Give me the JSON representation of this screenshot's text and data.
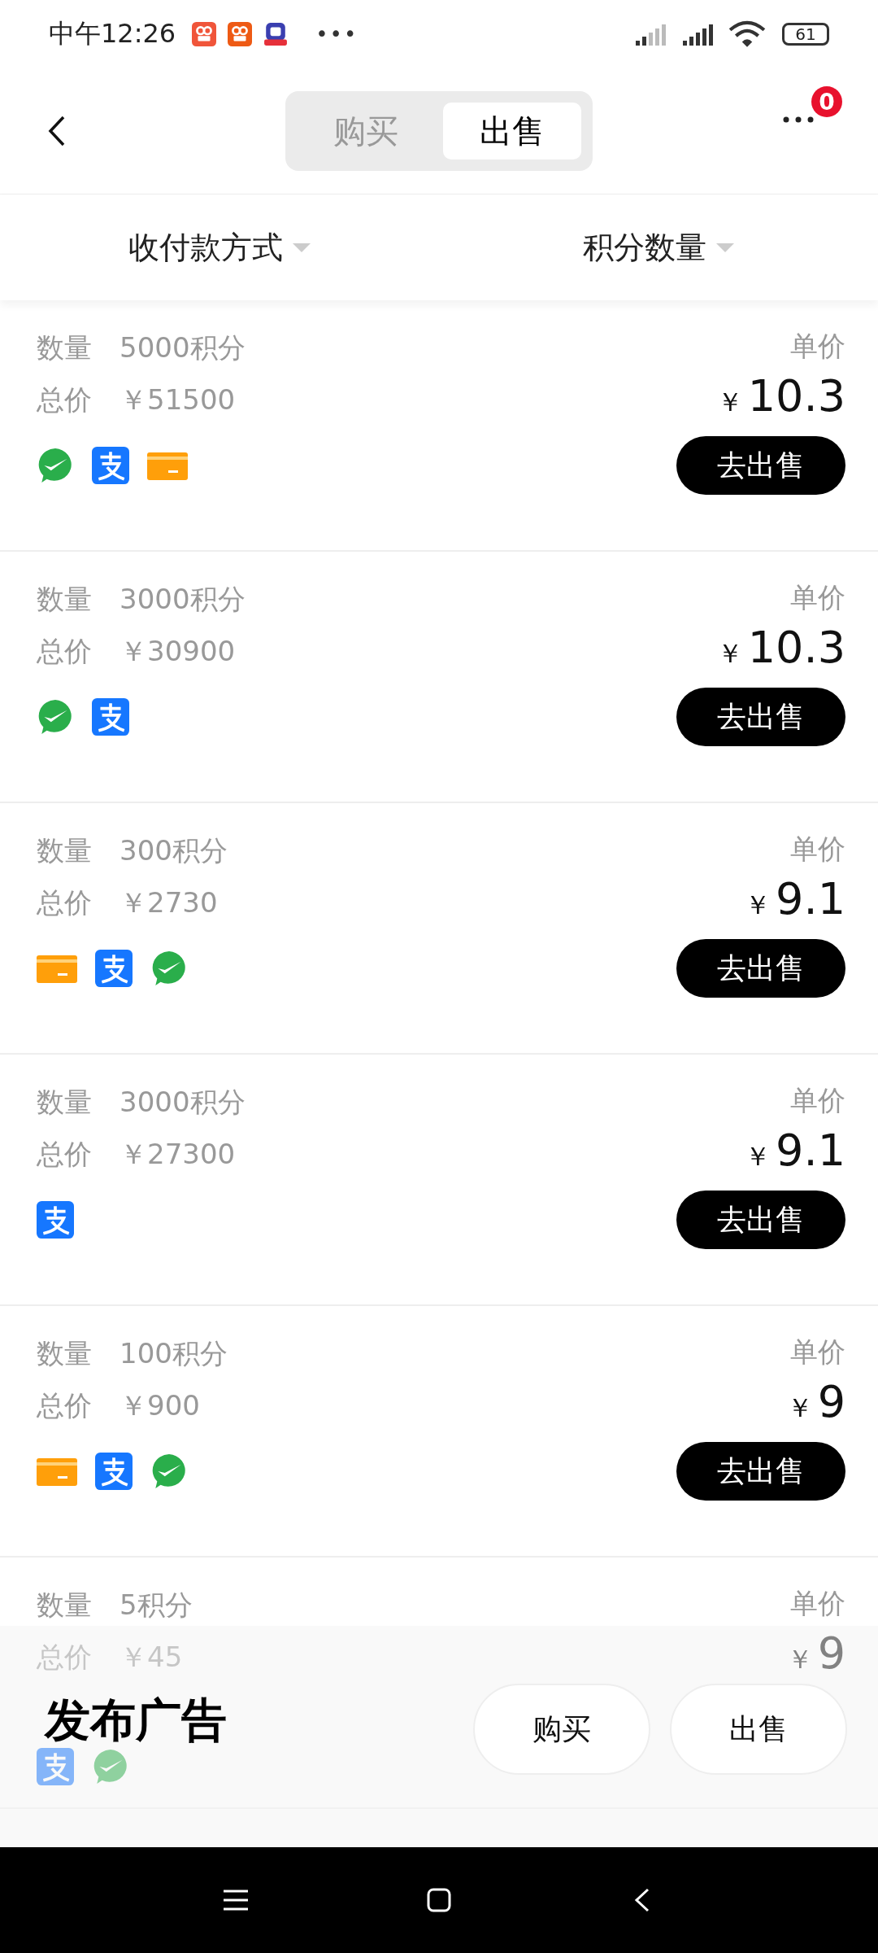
{
  "status_bar": {
    "time": "中午12:26",
    "more": "•••",
    "battery": "61"
  },
  "header": {
    "tabs": [
      {
        "label": "购买",
        "selected": false
      },
      {
        "label": "出售",
        "selected": true
      }
    ],
    "badge": "0"
  },
  "filters": [
    {
      "label": "收付款方式"
    },
    {
      "label": "积分数量"
    }
  ],
  "listings": [
    {
      "qty_label": "数量",
      "qty": "5000积分",
      "total_label": "总价",
      "total": "￥51500",
      "unit_label": "单价",
      "currency": "￥",
      "price": "10.3",
      "payments": [
        {
          "kind": "wechat"
        },
        {
          "kind": "alipay"
        },
        {
          "kind": "card"
        }
      ],
      "button": "去出售"
    },
    {
      "qty_label": "数量",
      "qty": "3000积分",
      "total_label": "总价",
      "total": "￥30900",
      "unit_label": "单价",
      "currency": "￥",
      "price": "10.3",
      "payments": [
        {
          "kind": "wechat"
        },
        {
          "kind": "alipay"
        }
      ],
      "button": "去出售"
    },
    {
      "qty_label": "数量",
      "qty": "300积分",
      "total_label": "总价",
      "total": "￥2730",
      "unit_label": "单价",
      "currency": "￥",
      "price": "9.1",
      "payments": [
        {
          "kind": "card"
        },
        {
          "kind": "alipay"
        },
        {
          "kind": "wechat"
        }
      ],
      "button": "去出售"
    },
    {
      "qty_label": "数量",
      "qty": "3000积分",
      "total_label": "总价",
      "total": "￥27300",
      "unit_label": "单价",
      "currency": "￥",
      "price": "9.1",
      "payments": [
        {
          "kind": "alipay"
        }
      ],
      "button": "去出售"
    },
    {
      "qty_label": "数量",
      "qty": "100积分",
      "total_label": "总价",
      "total": "￥900",
      "unit_label": "单价",
      "currency": "￥",
      "price": "9",
      "payments": [
        {
          "kind": "card"
        },
        {
          "kind": "alipay"
        },
        {
          "kind": "wechat"
        }
      ],
      "button": "去出售"
    },
    {
      "qty_label": "数量",
      "qty": "5积分",
      "total_label": "总价",
      "total": "￥45",
      "unit_label": "单价",
      "currency": "￥",
      "price": "9",
      "payments": [
        {
          "kind": "alipay"
        },
        {
          "kind": "wechat"
        }
      ]
    }
  ],
  "publish_sheet": {
    "title": "发布广告",
    "buttons": [
      "购买",
      "出售"
    ]
  }
}
